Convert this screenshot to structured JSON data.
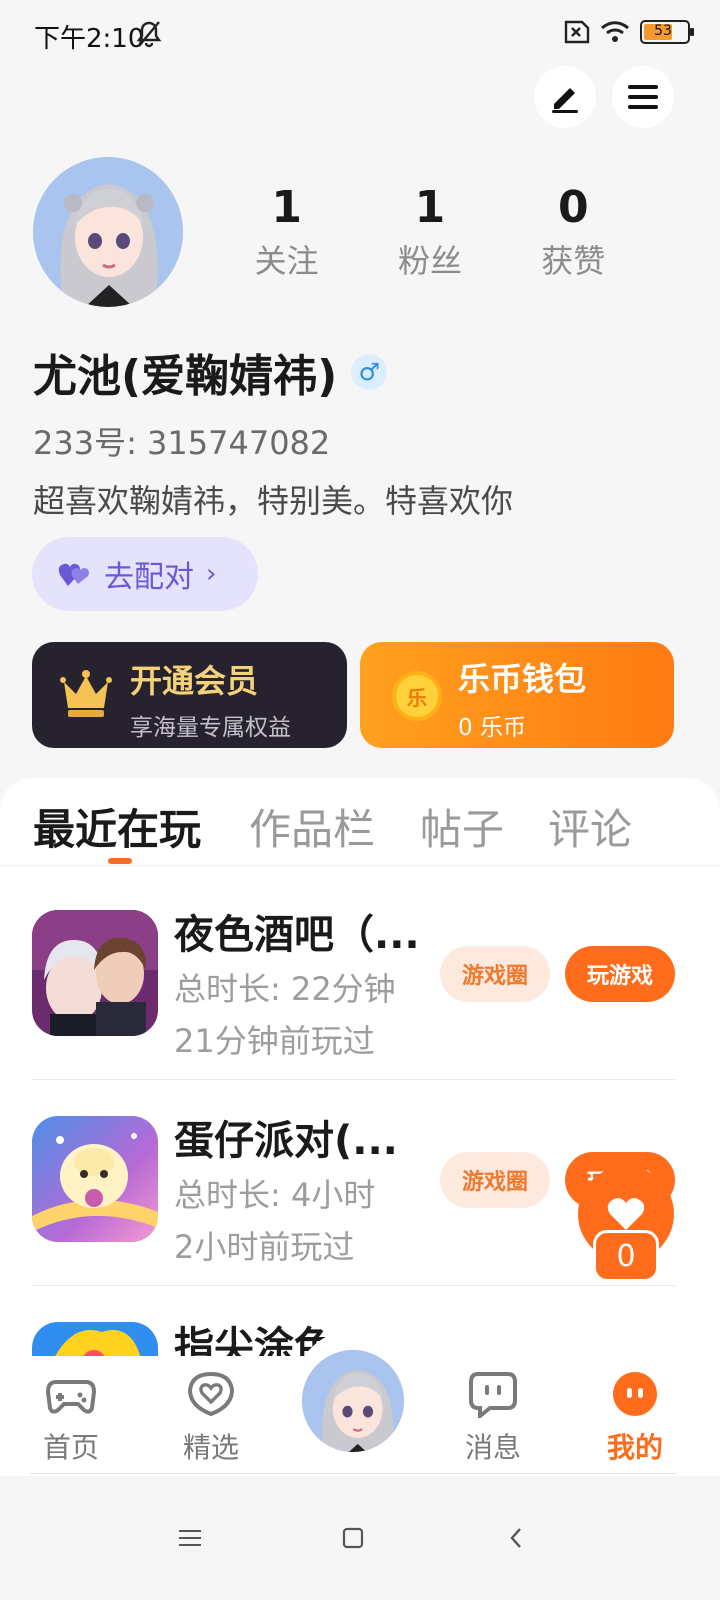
{
  "status_bar": {
    "time": "下午2:10",
    "battery": "53"
  },
  "profile": {
    "stats": [
      {
        "value": "1",
        "label": "关注"
      },
      {
        "value": "1",
        "label": "粉丝"
      },
      {
        "value": "0",
        "label": "获赞"
      }
    ],
    "username": "尤池(爱鞠婧祎)",
    "gender_symbol": "♂",
    "uid": "233号: 315747082",
    "bio": "超喜欢鞠婧祎，特别美。特喜欢你",
    "pair_label": "去配对",
    "pair_chevron": "›"
  },
  "cards": {
    "vip": {
      "title": "开通会员",
      "subtitle": "享海量专属权益"
    },
    "wallet": {
      "coin_glyph": "乐",
      "title": "乐币钱包",
      "subtitle": "0 乐币"
    }
  },
  "tabs": [
    "最近在玩",
    "作品栏",
    "帖子",
    "评论"
  ],
  "games": [
    {
      "name": "夜色酒吧（...",
      "duration": "总时长: 22分钟",
      "last_played": "21分钟前玩过",
      "circle_label": "游戏圈",
      "play_label": "玩游戏"
    },
    {
      "name": "蛋仔派对(...",
      "duration": "总时长: 4小时",
      "last_played": "2小时前玩过",
      "circle_label": "游戏圈",
      "play_label": "玩游戏"
    },
    {
      "name": "指尖涂色",
      "duration": "",
      "last_played": "",
      "circle_label": "",
      "play_label": ""
    }
  ],
  "float_like": {
    "count": "0"
  },
  "bottom_nav": [
    {
      "label": "首页",
      "icon": "gamepad-icon"
    },
    {
      "label": "精选",
      "icon": "heart-chat-icon"
    },
    {
      "label": "消息",
      "icon": "message-icon"
    },
    {
      "label": "我的",
      "icon": "me-icon"
    }
  ],
  "colors": {
    "accent": "#ff6d1c",
    "vip_gold": "#f5d27a",
    "pair_purple": "#6a58d6"
  }
}
